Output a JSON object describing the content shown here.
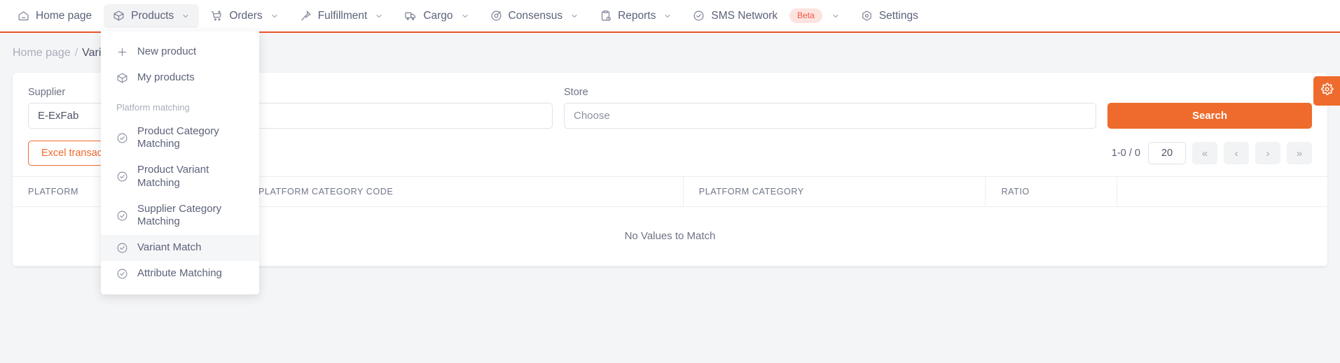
{
  "nav": {
    "items": [
      {
        "label": "Home page",
        "icon": "home-icon",
        "caret": false,
        "active": false
      },
      {
        "label": "Products",
        "icon": "box-icon",
        "caret": true,
        "active": true
      },
      {
        "label": "Orders",
        "icon": "cart-plus-icon",
        "caret": true,
        "active": false
      },
      {
        "label": "Fulfillment",
        "icon": "pin-icon",
        "caret": true,
        "active": false
      },
      {
        "label": "Cargo",
        "icon": "truck-icon",
        "caret": true,
        "active": false
      },
      {
        "label": "Consensus",
        "icon": "target-icon",
        "caret": true,
        "active": false
      },
      {
        "label": "Reports",
        "icon": "clipboard-clock-icon",
        "caret": true,
        "active": false
      },
      {
        "label": "SMS Network",
        "icon": "check-circle-icon",
        "caret": true,
        "active": false,
        "badge": "Beta"
      },
      {
        "label": "Settings",
        "icon": "gear-hex-icon",
        "caret": false,
        "active": false
      }
    ]
  },
  "dropdown": {
    "items": [
      {
        "label": "New product",
        "icon": "plus-icon",
        "highlight": false
      },
      {
        "label": "My products",
        "icon": "box-icon",
        "highlight": false
      }
    ],
    "section_label": "Platform matching",
    "matching_items": [
      {
        "label": "Product Category Matching",
        "icon": "check-circle-icon",
        "highlight": false
      },
      {
        "label": "Product Variant Matching",
        "icon": "check-circle-icon",
        "highlight": false
      },
      {
        "label": "Supplier Category Matching",
        "icon": "check-circle-icon",
        "highlight": false
      },
      {
        "label": "Variant Match",
        "icon": "check-circle-icon",
        "highlight": true
      },
      {
        "label": "Attribute Matching",
        "icon": "check-circle-icon",
        "highlight": false
      }
    ]
  },
  "breadcrumb": {
    "root": "Home page",
    "separator": "/",
    "current": "Variant Match"
  },
  "filters": {
    "supplier_label": "Supplier",
    "supplier_value": "E-ExFab",
    "middle_label": "",
    "middle_value": "",
    "store_label": "Store",
    "store_placeholder": "Choose",
    "search_label": "Search"
  },
  "actions": {
    "excel_label": "Excel transactions"
  },
  "pager": {
    "count": "1-0 / 0",
    "page_size": "20",
    "first": "«",
    "prev": "‹",
    "next": "›",
    "last": "»"
  },
  "table": {
    "columns": [
      "PLATFORM",
      "PLATFORM CATEGORY CODE",
      "PLATFORM CATEGORY",
      "RATIO",
      ""
    ],
    "empty_message": "No Values to Match",
    "rows": []
  },
  "gear_tab": {
    "icon": "gear-icon"
  },
  "colors": {
    "accent": "#ee6b2d",
    "accent_border": "#e8552c",
    "beta_bg": "#fde3e0",
    "beta_text": "#f15642",
    "text": "#5c6279",
    "muted": "#a9adba"
  }
}
